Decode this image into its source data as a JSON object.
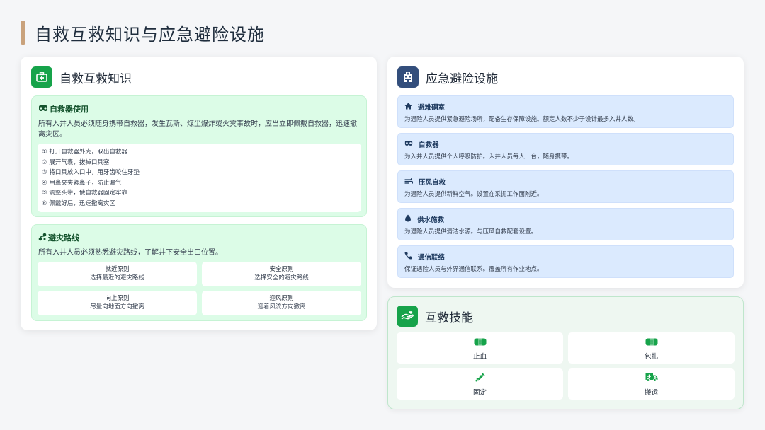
{
  "page": {
    "title": "自救互救知识与应急避险设施"
  },
  "colors": {
    "accent_bar": "#c9a27c",
    "green": "#16a34a",
    "navy": "#334e7c",
    "green_bg": "#dcfce7",
    "blue_bg": "#dbeafe"
  },
  "left_card": {
    "title": "自救互救知识",
    "icon": "first-aid-kit-icon",
    "rescuer": {
      "title": "自救器使用",
      "icon": "mask-icon",
      "desc": "所有入井人员必须随身携带自救器，发生瓦斯、煤尘爆炸或火灾事故时，应当立即佩戴自救器，迅速撤离灾区。",
      "steps": [
        "① 打开自救器外壳，取出自救器",
        "② 展开气囊，拔掉口具塞",
        "③ 将口具放入口中，用牙齿咬住牙垫",
        "④ 用鼻夹夹紧鼻子，防止漏气",
        "⑤ 调整头带，使自救器固定牢靠",
        "⑥ 佩戴好后，迅速撤离灾区"
      ]
    },
    "route": {
      "title": "避灾路线",
      "icon": "route-icon",
      "desc": "所有入井人员必须熟悉避灾路线，了解井下安全出口位置。",
      "principles": [
        {
          "name": "就近原则",
          "desc": "选择最近的避灾路线"
        },
        {
          "name": "安全原则",
          "desc": "选择安全的避灾路线"
        },
        {
          "name": "向上原则",
          "desc": "尽量向地面方向撤离"
        },
        {
          "name": "迎风原则",
          "desc": "迎着风流方向撤离"
        }
      ]
    }
  },
  "facility_card": {
    "title": "应急避险设施",
    "icon": "hospital-icon",
    "items": [
      {
        "title": "避难硐室",
        "icon": "house-icon",
        "desc": "为遇险人员提供紧急避险场所，配备生存保障设施。额定人数不少于设计最多入井人数。"
      },
      {
        "title": "自救器",
        "icon": "mask-icon",
        "desc": "为入井人员提供个人呼吸防护。入井人员每人一台，随身携带。"
      },
      {
        "title": "压风自救",
        "icon": "wind-icon",
        "desc": "为遇险人员提供新鲜空气。设置在采掘工作面附近。"
      },
      {
        "title": "供水施救",
        "icon": "water-drop-icon",
        "desc": "为遇险人员提供清洁水源。与压风自救配套设置。"
      },
      {
        "title": "通信联络",
        "icon": "phone-icon",
        "desc": "保证遇险人员与外界通信联系。覆盖所有作业地点。"
      }
    ]
  },
  "skills_card": {
    "title": "互救技能",
    "icon": "helping-hands-icon",
    "items": [
      {
        "label": "止血",
        "icon": "bandage-icon"
      },
      {
        "label": "包扎",
        "icon": "bandage-icon"
      },
      {
        "label": "固定",
        "icon": "syringe-icon"
      },
      {
        "label": "搬运",
        "icon": "ambulance-icon"
      }
    ]
  }
}
